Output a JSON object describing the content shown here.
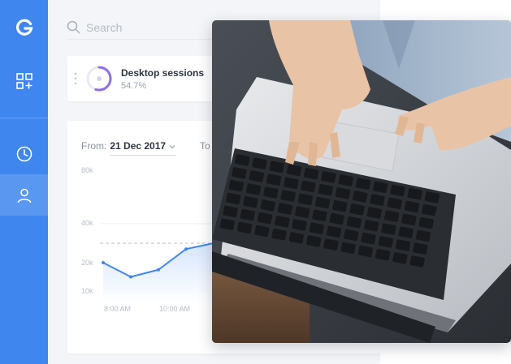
{
  "sidebar": {
    "logo": "G",
    "icons": [
      "apps-add-icon",
      "clock-icon",
      "user-icon"
    ],
    "accent": "#3f86ef"
  },
  "search": {
    "placeholder": "Search"
  },
  "sessions_card": {
    "title": "Desktop sessions",
    "value": "54.7%",
    "percent": 0.547
  },
  "date_range": {
    "from_label": "From:",
    "from_value": "21 Dec 2017",
    "to_label": "To"
  },
  "chart_data": {
    "type": "area",
    "yticks": [
      "80k",
      "40k",
      "20k",
      "10k"
    ],
    "xticks": [
      "8:00 AM",
      "10:00 AM"
    ],
    "reference_line": 30000,
    "series": [
      {
        "values": [
          20000,
          15000,
          17500,
          27000,
          30000,
          32000
        ]
      }
    ],
    "line_color": "#3f86ef"
  }
}
